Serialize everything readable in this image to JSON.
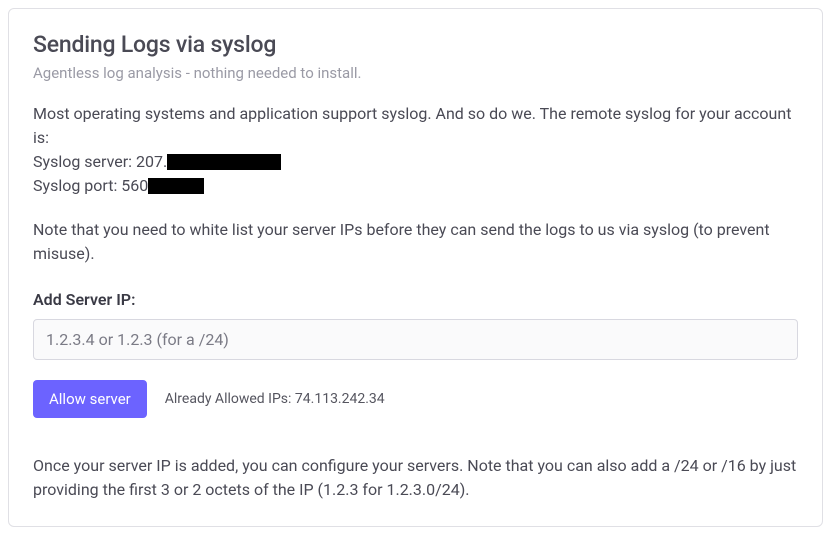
{
  "header": {
    "title": "Sending Logs via syslog",
    "subtitle": "Agentless log analysis - nothing needed to install."
  },
  "intro": {
    "text": "Most operating systems and application support syslog. And so do we. The remote syslog for your account is:"
  },
  "server_info": {
    "server_label": "Syslog server: 207.",
    "port_label": "Syslog port: 560"
  },
  "whitelist_note": "Note that you need to white list your server IPs before they can send the logs to us via syslog (to prevent misuse).",
  "form": {
    "label": "Add Server IP:",
    "placeholder": "1.2.3.4 or 1.2.3 (for a /24)",
    "button_label": "Allow server",
    "allowed_label": "Already Allowed IPs: 74.113.242.34"
  },
  "footer": {
    "text": "Once your server IP is added, you can configure your servers. Note that you can also add a /24 or /16 by just providing the first 3 or 2 octets of the IP (1.2.3 for 1.2.3.0/24)."
  }
}
